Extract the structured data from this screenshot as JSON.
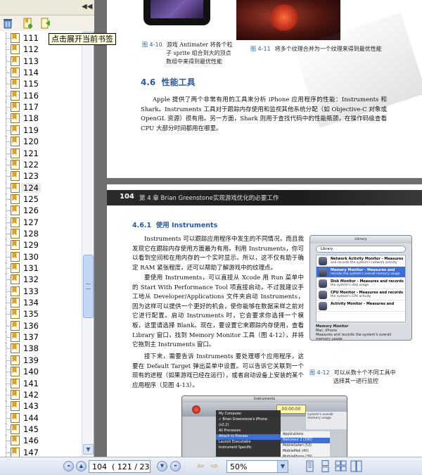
{
  "bookmarks": {
    "tooltip": "点击展开当前书签",
    "collapse_glyph": "◀◀",
    "items": [
      "111",
      "112",
      "113",
      "114",
      "115",
      "116",
      "117",
      "118",
      "119",
      "120",
      "121",
      "122",
      "123",
      "124",
      "125",
      "126",
      "127",
      "128",
      "129",
      "130",
      "131",
      "132",
      "133",
      "134",
      "135",
      "136",
      "137",
      "138",
      "139",
      "140",
      "141",
      "142",
      "143",
      "144",
      "145",
      "146",
      "147"
    ],
    "selected": "124",
    "toolbar_icons": [
      "delete-bookmark-icon",
      "new-bookmark-icon",
      "expand-bookmark-icon"
    ]
  },
  "page_prev": {
    "fig10_num": "图 4-10",
    "fig10_caption_1": "游戏 Antimater 将各个粒",
    "fig10_caption_2": "子 sprite 组合到大的顶点",
    "fig10_caption_3": "数组中来得到最优性能",
    "fig11_num": "图 4-11",
    "fig11_caption": "将多个纹理合并为一个纹理来得到最优性能",
    "section_num": "4.6",
    "section_title": "性能工具",
    "para": "Apple 提供了两个非常有用的工具来分析 iPhone 应用程序的性能：Instruments 和 Shark。Instruments 工具对于跟踪内存使用和监视其他系统分配（如 Objective-C 对象或 OpenGL 资源）很有用。另一方面，Shark 则用于查找代码中的性能瓶颈，在操作码级查看 CPU 大部分时间都用在哪里。"
  },
  "page_current": {
    "page_number": "104",
    "chapter": "第 4 章  Brian Greenstone实现游戏优化的必要工作",
    "subsection_num": "4.6.1",
    "subsection_title": "使用 Instruments",
    "para1": "Instruments 可以跟踪应用程序中发生的不同情况，而且我发现它在跟踪内存使用方面最为有用。利用 Instruments，你可以看到空间和在用内存的一个实时显示。所以，这不仅有助于确定 RAM 紧张程度，还可以帮助了解游戏中的纹理点。",
    "para2": "要使用 Instruments，可以直接从 Xcode 用 Run 菜单中的 Start With Performance Tool 项直接启动，不过我建议手工地从 Developer/Applications 文件夹启动 Instruments，因为这样可以提供一个更好的机会，使你能够在数据采样之前对它进行配置。启动 Instruments 时，它会要求你选择一个模板，这里请选择 Blank。现在，要设置它来跟踪内存使用，查看 Library 窗口，找到 Memory Monitor 工具（图 4-12），并将它拖到主 Instruments 窗口。",
    "para3": "接下来，需要告诉 Instruments 要处理哪个应用程序，这要在 Default Target 弹出菜单中设置。可以告诉它关联到一个现有的进程（如果游戏已经在运行），或者启动设备上安装的某个应用程序（见图 4-13）。",
    "fig12_num": "图 4-12",
    "fig12_caption_1": "可以从数十个不同工具中",
    "fig12_caption_2": "选择其一进行监控",
    "library": {
      "title": "Library",
      "select": "Library",
      "items": [
        {
          "name": "Network Activity Monitor - Measures",
          "desc": "and records the system's network activity"
        },
        {
          "name": "Memory Monitor - Measures and",
          "desc": "records the system's overall memory usage"
        },
        {
          "name": "Disk Monitor - Measures and records",
          "desc": "the system's disk usage"
        },
        {
          "name": "CPU Monitor - Measures and records",
          "desc": "the system's CPU activity"
        },
        {
          "name": "Activity Monitor - Measures and",
          "desc": ""
        }
      ],
      "detail_title": "Memory Monitor",
      "detail_sub": "Mac, iPhone",
      "detail_desc": "Measures and records the system's overall memory usage"
    },
    "instruments": {
      "title": "Instruments",
      "lcd": "00:00:00",
      "menu": [
        "My Computer",
        "✓ Brian Greenstone's iPhone (v2.2)",
        "All Processes",
        "Attach to Process",
        "Launch Executable",
        "Instrument Specific"
      ],
      "submenu": [
        "Applications",
        "Nanosaur 2 (190)",
        "MobileSafari (53)",
        "MobileMail (40)",
        "MobilePhone (39)"
      ],
      "track_label": "system's overall memory usage"
    }
  },
  "nav": {
    "page_value": "104",
    "page_count": "( 121 / 23",
    "zoom": "50%",
    "buttons": [
      "first-page-button",
      "prev-page-button",
      "next-page-button",
      "last-page-button"
    ],
    "view_modes": [
      "single-page",
      "continuous",
      "facing",
      "continuous-facing"
    ]
  },
  "colors": {
    "accent_blue": "#2c5aa0",
    "header_bar": "#1c1c1c",
    "tooltip_bg": "#ffffe1"
  }
}
